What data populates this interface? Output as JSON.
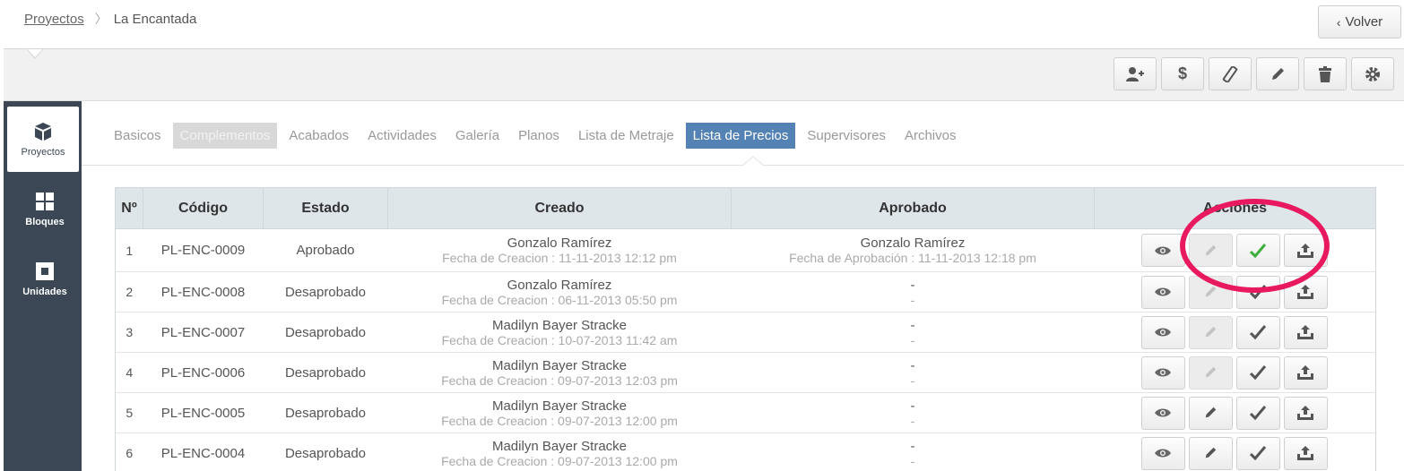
{
  "breadcrumb": {
    "parent": "Proyectos",
    "current": "La Encantada"
  },
  "header": {
    "back_label": "Volver"
  },
  "toolbar": {
    "buttons": [
      {
        "icon": "add-user-icon"
      },
      {
        "icon": "dollar-icon"
      },
      {
        "icon": "ruler-icon"
      },
      {
        "icon": "pencil-icon"
      },
      {
        "icon": "trash-icon"
      },
      {
        "icon": "gear-icon"
      }
    ]
  },
  "sidebar": {
    "items": [
      {
        "label": "Proyectos",
        "icon": "cube-icon",
        "active": true
      },
      {
        "label": "Bloques",
        "icon": "grid-icon",
        "active": false
      },
      {
        "label": "Unidades",
        "icon": "square-icon",
        "active": false
      }
    ]
  },
  "tabs": [
    {
      "label": "Basicos",
      "state": "normal"
    },
    {
      "label": "Complementos",
      "state": "disabled"
    },
    {
      "label": "Acabados",
      "state": "normal"
    },
    {
      "label": "Actividades",
      "state": "normal"
    },
    {
      "label": "Galería",
      "state": "normal"
    },
    {
      "label": "Planos",
      "state": "normal"
    },
    {
      "label": "Lista de Metraje",
      "state": "normal"
    },
    {
      "label": "Lista de Precios",
      "state": "active"
    },
    {
      "label": "Supervisores",
      "state": "normal"
    },
    {
      "label": "Archivos",
      "state": "normal"
    }
  ],
  "table": {
    "headers": [
      "Nº",
      "Código",
      "Estado",
      "Creado",
      "Aprobado",
      "Acciones"
    ],
    "rows": [
      {
        "n": "1",
        "code": "PL-ENC-0009",
        "status": "Aprobado",
        "created_by": "Gonzalo Ramírez",
        "created_date": "Fecha de Creacion : 11-11-2013 12:12 pm",
        "approved_by": "Gonzalo Ramírez",
        "approved_date": "Fecha de Aprobación : 11-11-2013 12:18 pm",
        "edit_disabled": true,
        "approved": true
      },
      {
        "n": "2",
        "code": "PL-ENC-0008",
        "status": "Desaprobado",
        "created_by": "Gonzalo Ramírez",
        "created_date": "Fecha de Creacion : 06-11-2013 05:50 pm",
        "approved_by": "-",
        "approved_date": "-",
        "edit_disabled": true,
        "approved": false
      },
      {
        "n": "3",
        "code": "PL-ENC-0007",
        "status": "Desaprobado",
        "created_by": "Madilyn Bayer Stracke",
        "created_date": "Fecha de Creacion : 10-07-2013 11:42 am",
        "approved_by": "-",
        "approved_date": "-",
        "edit_disabled": true,
        "approved": false
      },
      {
        "n": "4",
        "code": "PL-ENC-0006",
        "status": "Desaprobado",
        "created_by": "Madilyn Bayer Stracke",
        "created_date": "Fecha de Creacion : 09-07-2013 12:03 pm",
        "approved_by": "-",
        "approved_date": "-",
        "edit_disabled": true,
        "approved": false
      },
      {
        "n": "5",
        "code": "PL-ENC-0005",
        "status": "Desaprobado",
        "created_by": "Madilyn Bayer Stracke",
        "created_date": "Fecha de Creacion : 09-07-2013 12:00 pm",
        "approved_by": "-",
        "approved_date": "-",
        "edit_disabled": false,
        "approved": false
      },
      {
        "n": "6",
        "code": "PL-ENC-0004",
        "status": "Desaprobado",
        "created_by": "Madilyn Bayer Stracke",
        "created_date": "Fecha de Creacion : 09-07-2013 12:00 pm",
        "approved_by": "-",
        "approved_date": "-",
        "edit_disabled": false,
        "approved": false
      }
    ]
  },
  "colors": {
    "accent": "#5482b5",
    "sidebar": "#3b4755",
    "highlight": "#e8195f",
    "approved_check": "#3cae3c"
  }
}
